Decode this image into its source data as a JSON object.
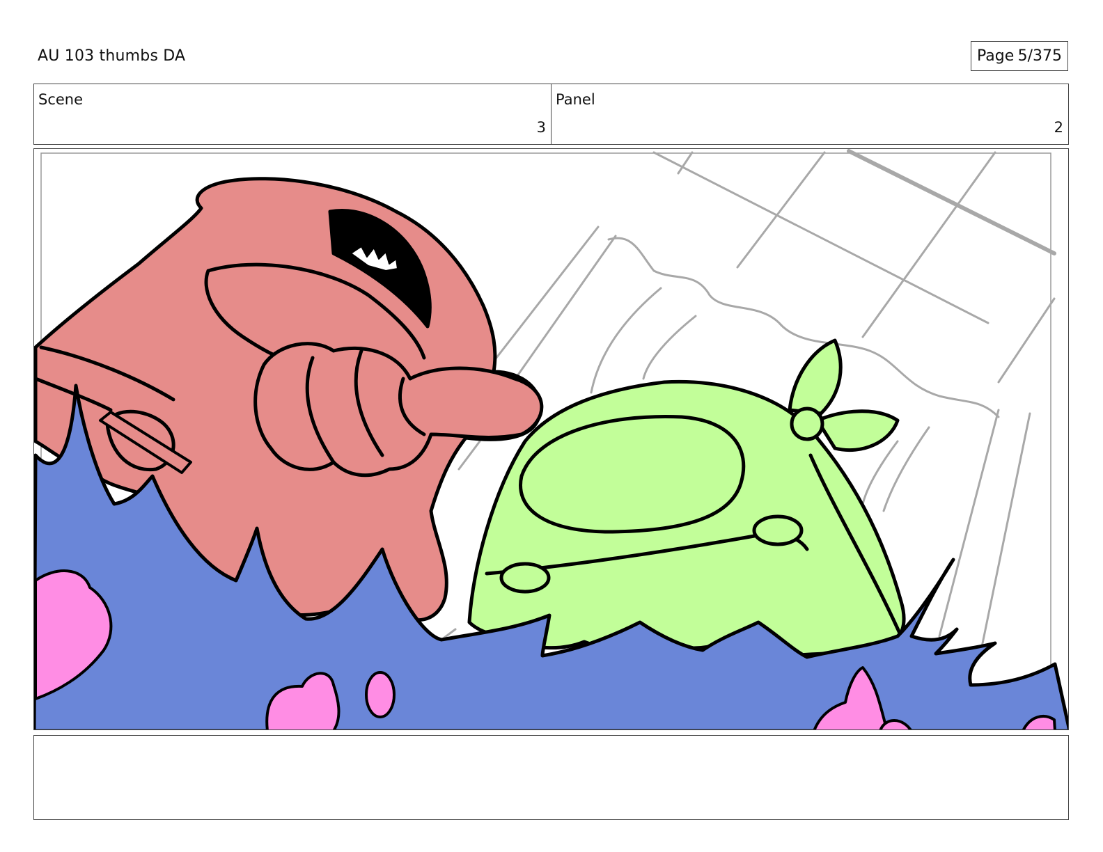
{
  "header": {
    "title": "AU 103 thumbs DA",
    "page_label": "Page",
    "page_value": "5/375"
  },
  "info": {
    "scene_label": "Scene",
    "scene_value": "3",
    "panel_label": "Panel",
    "panel_value": "2"
  },
  "notes": {
    "text": ""
  },
  "colors": {
    "pink_character": "#e68c8a",
    "green_character": "#c2fe99",
    "blanket": "#6a86d8",
    "heart": "#ff8de4",
    "sketch_line": "#a8a8a8",
    "ink": "#000000"
  }
}
